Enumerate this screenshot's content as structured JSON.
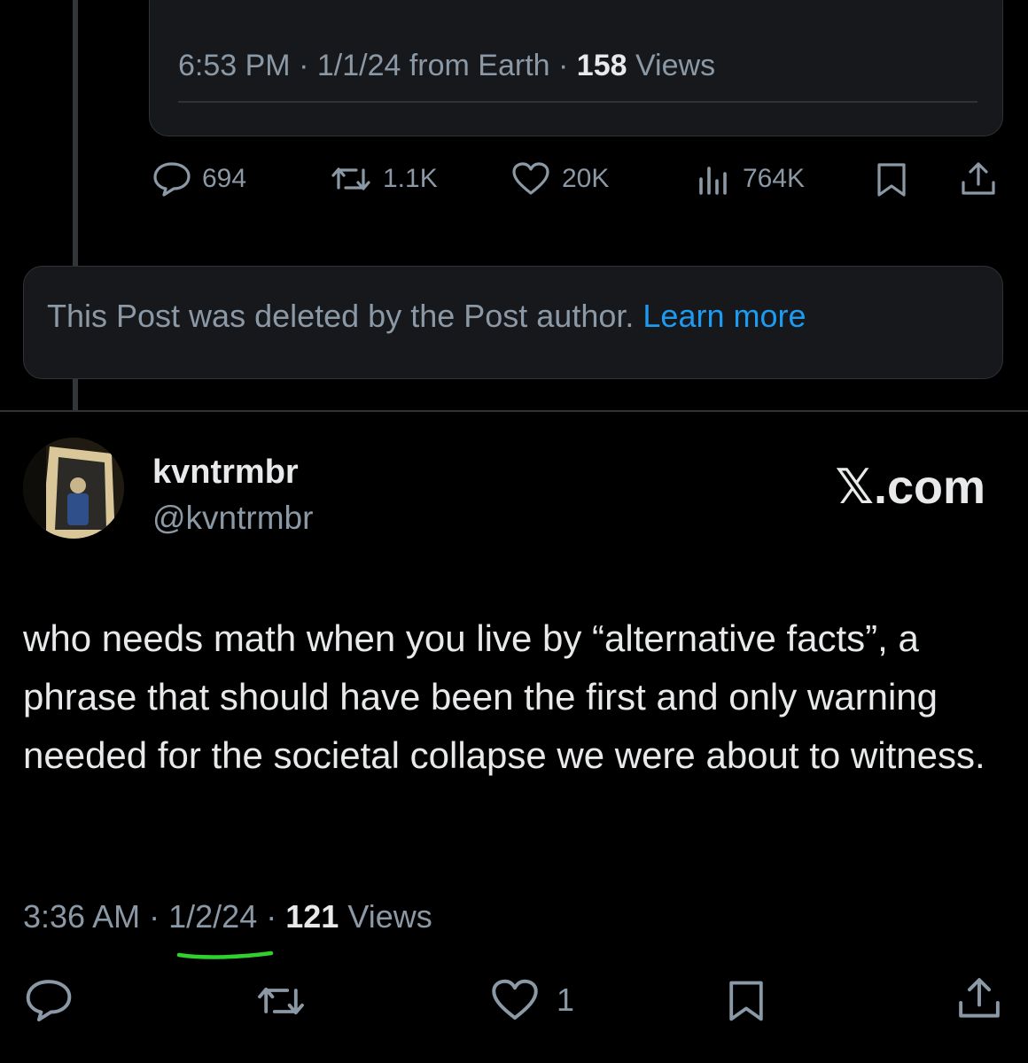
{
  "quoted_post": {
    "time": "6:53 PM",
    "date": "1/1/24",
    "source": "from Earth",
    "separator": "·",
    "views_count": "158",
    "views_label": "Views"
  },
  "thread_actions": {
    "replies": "694",
    "reposts": "1.1K",
    "likes": "20K",
    "views": "764K"
  },
  "deleted_notice": {
    "text": "This Post was deleted by the Post author.",
    "link": "Learn more"
  },
  "post": {
    "display_name": "kvntrmbr",
    "handle": "@kvntrmbr",
    "brand": "𝕏.com",
    "text": "who needs math when you live by “alternative facts”, a phrase that should have been the first and only warning needed for the societal collapse we were about to witness.",
    "time": "3:36 AM",
    "date": "1/2/24",
    "separator": "·",
    "views_count": "121",
    "views_label": "Views",
    "likes": "1"
  },
  "colors": {
    "background": "#000000",
    "card": "#16181c",
    "muted_text": "#8b98a5",
    "link": "#1d9bf0",
    "highlight_mark": "#2fd12f"
  },
  "icons": [
    "reply-icon",
    "repost-icon",
    "like-icon",
    "views-icon",
    "bookmark-icon",
    "share-icon"
  ]
}
